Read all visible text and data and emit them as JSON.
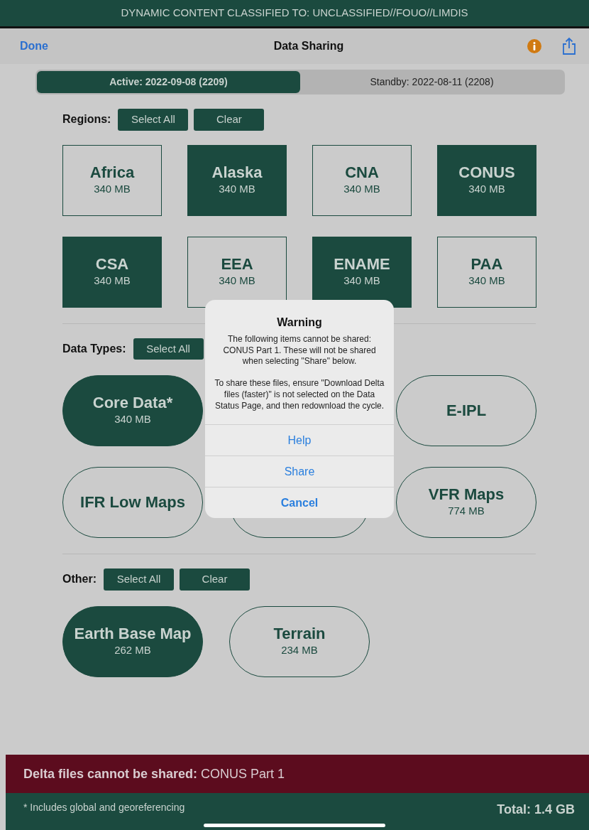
{
  "classification_banner": "DYNAMIC CONTENT CLASSIFIED TO: UNCLASSIFIED//FOUO//LIMDIS",
  "nav": {
    "left_button": "Done",
    "title": "Data Sharing"
  },
  "cycles": [
    {
      "label": "Active: 2022-09-08 (2209)",
      "selected": true
    },
    {
      "label": "Standby: 2022-08-11 (2208)",
      "selected": false
    }
  ],
  "sections": [
    {
      "label": "Regions:",
      "buttons": [
        "Select All",
        "Clear"
      ],
      "kind": "tile",
      "items": [
        {
          "name": "Africa",
          "size": "340 MB",
          "selected": false
        },
        {
          "name": "Alaska",
          "size": "340 MB",
          "selected": true
        },
        {
          "name": "CNA",
          "size": "340 MB",
          "selected": false
        },
        {
          "name": "CONUS",
          "size": "340 MB",
          "selected": true
        },
        {
          "name": "CSA",
          "size": "340 MB",
          "selected": true
        },
        {
          "name": "EEA",
          "size": "340 MB",
          "selected": false
        },
        {
          "name": "ENAME",
          "size": "340 MB",
          "selected": true
        },
        {
          "name": "PAA",
          "size": "340 MB",
          "selected": false
        }
      ]
    },
    {
      "label": "Data Types:",
      "buttons": [
        "Select All"
      ],
      "kind": "pill",
      "items": [
        {
          "kind": "option",
          "name": "Core Data*",
          "size": "340 MB",
          "selected": true
        },
        {
          "kind": "covered"
        },
        {
          "kind": "option",
          "name": "E-IPL",
          "selected": false
        },
        {
          "kind": "option",
          "name": "IFR Low Maps",
          "selected": false
        },
        {
          "kind": "option",
          "selected": false
        },
        {
          "kind": "option",
          "name": "VFR Maps",
          "size": "774 MB",
          "selected": false
        }
      ]
    },
    {
      "label": "Other:",
      "buttons": [
        "Select All",
        "Clear"
      ],
      "kind": "pill",
      "items": [
        {
          "name": "Earth Base Map",
          "size": "262 MB",
          "selected": true
        },
        {
          "name": "Terrain",
          "size": "234 MB",
          "selected": false
        }
      ]
    }
  ],
  "alert": {
    "title": "Warning",
    "message": "The following items cannot be shared: CONUS Part 1. These will not be shared when selecting \"Share\" below.\n\nTo share these files, ensure \"Download Delta files (faster)\" is not selected on the Data Status Page, and then redownload the cycle.",
    "actions": [
      {
        "label": "Help",
        "kind": "normal"
      },
      {
        "label": "Share",
        "kind": "normal"
      },
      {
        "label": "Cancel",
        "kind": "cancel"
      }
    ]
  },
  "delta_notice": "**Delta files cannot be shared:** CONUS Part 1",
  "footer": {
    "note": "* Includes global and georeferencing",
    "total": "Total: 1.4 GB"
  }
}
